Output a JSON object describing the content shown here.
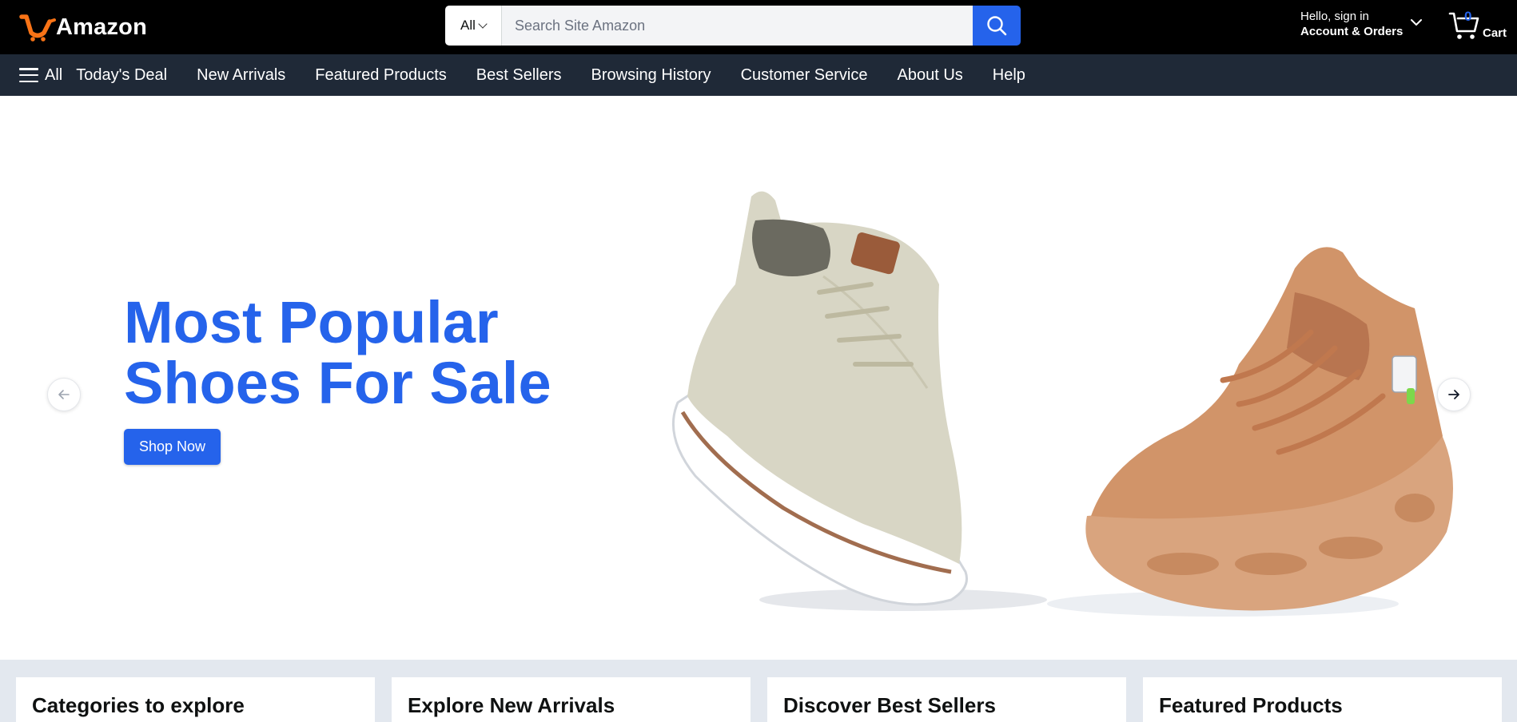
{
  "header": {
    "logo_text": "Amazon",
    "search_category": "All",
    "search_placeholder": "Search Site Amazon",
    "account_greeting": "Hello, sign in",
    "account_label": "Account & Orders",
    "cart_count": "0",
    "cart_label": "Cart"
  },
  "nav": {
    "all_label": "All",
    "links": [
      "Today's Deal",
      "New Arrivals",
      "Featured Products",
      "Best Sellers",
      "Browsing History",
      "Customer Service",
      "About Us",
      "Help"
    ]
  },
  "hero": {
    "title_line1": "Most Popular",
    "title_line2": "Shoes For Sale",
    "cta_label": "Shop Now"
  },
  "cards": [
    {
      "title": "Categories to explore"
    },
    {
      "title": "Explore New Arrivals"
    },
    {
      "title": "Discover Best Sellers"
    },
    {
      "title": "Featured Products"
    }
  ],
  "colors": {
    "accent": "#2563eb",
    "header_bg": "#000000",
    "nav_bg": "#1f2937",
    "logo_orange": "#f97316",
    "section_bg": "#e3e8ef"
  },
  "icons": {
    "logo": "smile-cart-logo-icon",
    "search": "search-icon",
    "account_chevron": "chevron-down-icon",
    "cart": "cart-icon",
    "menu": "hamburger-menu-icon",
    "prev": "arrow-left-icon",
    "next": "arrow-right-icon"
  }
}
